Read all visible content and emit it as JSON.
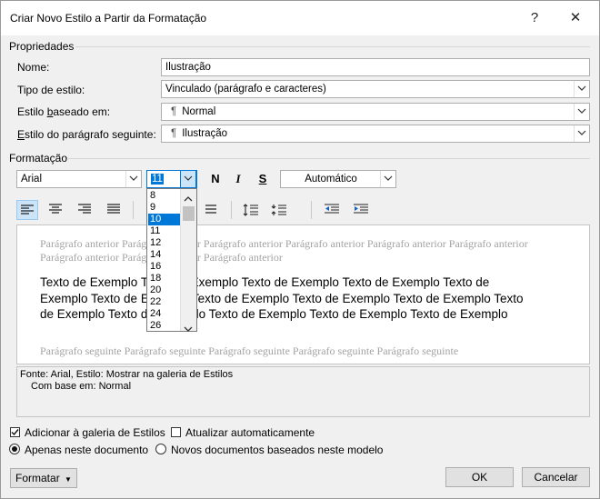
{
  "window": {
    "title": "Criar Novo Estilo a Partir da Formatação",
    "help": "?",
    "close": "✕"
  },
  "properties": {
    "header": "Propriedades",
    "name_label": "Nome:",
    "name_value": "Ilustração",
    "type_label": "Tipo de estilo:",
    "type_value": "Vinculado (parágrafo e caracteres)",
    "based_label": "Estilo baseado em:",
    "based_value": "Normal",
    "next_label": "Estilo do parágrafo seguinte:",
    "next_value": "Ilustração"
  },
  "formatting": {
    "header": "Formatação",
    "font": "Arial",
    "size": "11",
    "bold": "N",
    "italic": "I",
    "underline": "S",
    "color": "Automático",
    "size_options": [
      "8",
      "9",
      "10",
      "11",
      "12",
      "14",
      "16",
      "18",
      "20",
      "22",
      "24",
      "26"
    ],
    "selected_size_option": "10"
  },
  "preview": {
    "previous": "Parágrafo anterior Parágrafo anterior Parágrafo anterior Parágrafo anterior Parágrafo anterior Parágrafo anterior Parágrafo anterior Parágrafo anterior Parágrafo anterior",
    "sample": "Texto de Exemplo Texto de Exemplo Texto de Exemplo Texto de Exemplo Texto de Exemplo Texto de Exemplo Texto de Exemplo Texto de Exemplo Texto de Exemplo Texto de Exemplo Texto de Exemplo Texto de Exemplo Texto de Exemplo Texto de Exemplo",
    "next": "Parágrafo seguinte Parágrafo seguinte Parágrafo seguinte Parágrafo seguinte Parágrafo seguinte"
  },
  "description": {
    "line1": "Fonte: Arial, Estilo: Mostrar na galeria de Estilos",
    "line2": "Com base em: Normal"
  },
  "options": {
    "add_to_gallery": "Adicionar à galeria de Estilos",
    "auto_update": "Atualizar automaticamente",
    "only_this_doc": "Apenas neste documento",
    "new_docs": "Novos documentos baseados neste modelo"
  },
  "buttons": {
    "format": "Formatar",
    "ok": "OK",
    "cancel": "Cancelar"
  }
}
